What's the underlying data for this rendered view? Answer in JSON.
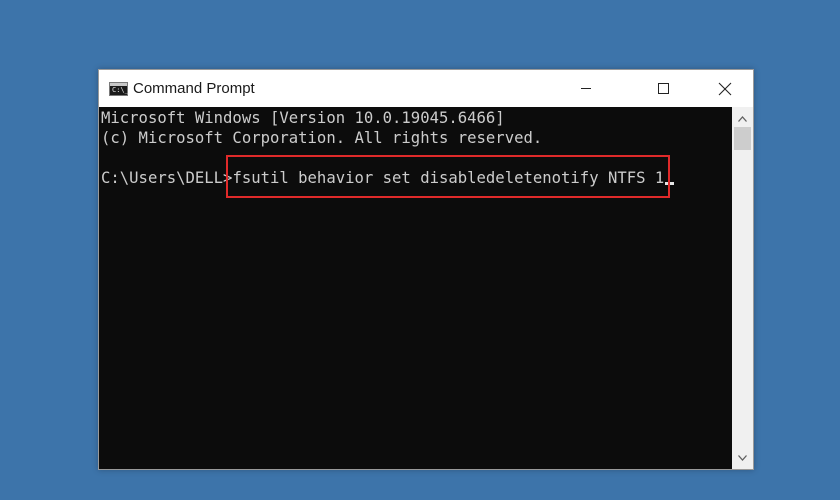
{
  "window": {
    "title": "Command Prompt",
    "icon": "cmd-icon",
    "icon_glyph": "C:\\_"
  },
  "controls": {
    "minimize": "minimize-icon",
    "maximize": "maximize-icon",
    "close": "close-icon"
  },
  "console": {
    "lines": [
      "Microsoft Windows [Version 10.0.19045.6466]",
      "(c) Microsoft Corporation. All rights reserved.",
      "",
      "C:\\Users\\DELL>fsutil behavior set disabledeletenotify NTFS 1"
    ],
    "prompt": "C:\\Users\\DELL>",
    "command": "fsutil behavior set disabledeletenotify NTFS 1"
  },
  "colors": {
    "desktop": "#3d74aa",
    "console_bg": "#0c0c0c",
    "console_text": "#cccccc",
    "highlight": "#e02a2a"
  }
}
